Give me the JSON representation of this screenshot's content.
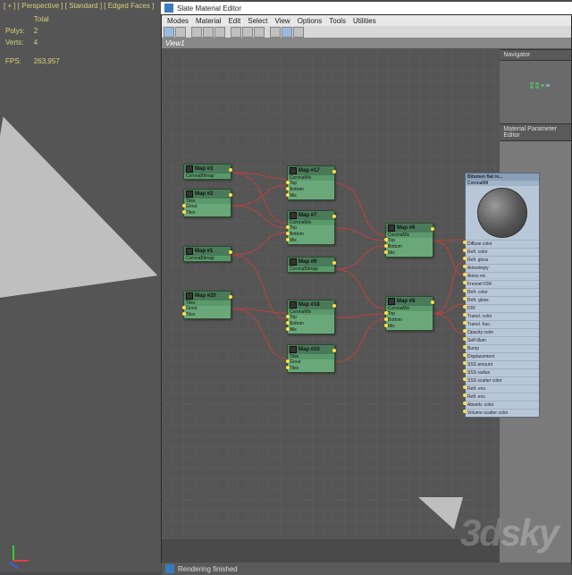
{
  "viewport": {
    "label": "[ + ] [ Perspective ] [ Standard ] [ Edged Faces ]",
    "stats": {
      "polys_l": "Polys:",
      "polys": "2",
      "verts_l": "Verts:",
      "verts": "4",
      "fps_l": "FPS:",
      "fps": "263,957",
      "total": "Total"
    }
  },
  "editor": {
    "title": "Slate Material Editor",
    "menus": [
      "Modes",
      "Material",
      "Edit",
      "Select",
      "View",
      "Options",
      "Tools",
      "Utilities"
    ],
    "view": "View1",
    "navigator": "Navigator",
    "paramEditor": "Material Parameter Editor",
    "status": "Rendering finished"
  },
  "nodes": {
    "n1": {
      "t": "Map #3",
      "s": "CoronaBitmap"
    },
    "n2": {
      "t": "Map #2",
      "s": "Tiles",
      "r": [
        "Grout",
        "Tiles"
      ]
    },
    "n3": {
      "t": "Map #1",
      "s": "CoronaBitmap"
    },
    "n4": {
      "t": "Map #20",
      "s": "Tiles",
      "r": [
        "Grout",
        "Tiles"
      ]
    },
    "n5": {
      "t": "Map #17",
      "s": "CoronaMix",
      "r": [
        "Top",
        "Bottom",
        "Mix"
      ]
    },
    "n6": {
      "t": "Map #7",
      "s": "CoronaMix",
      "r": [
        "Top",
        "Bottom",
        "Mix"
      ]
    },
    "n7": {
      "t": "Map #9",
      "s": "CoronaBitmap"
    },
    "n8": {
      "t": "Map #18",
      "s": "CoronaMix",
      "r": [
        "Top",
        "Bottom",
        "Mix"
      ]
    },
    "n9": {
      "t": "Map #10",
      "s": "Tiles",
      "r": [
        "Grout",
        "Tiles"
      ]
    },
    "n10": {
      "t": "Map #6",
      "s": "CoronaMix",
      "r": [
        "Top",
        "Bottom",
        "Mix"
      ]
    },
    "n11": {
      "t": "Map #8",
      "s": "CoronaMix",
      "r": [
        "Top",
        "Bottom",
        "Mix"
      ]
    }
  },
  "mat": {
    "t": "Bitumen flat ro...",
    "s": "CoronaMtl",
    "rows": [
      "Diffuse color",
      "Refl. color",
      "Refl. gloss",
      "Anisotropy",
      "Aniso rot.",
      "Fresnel IOR",
      "Refr. color",
      "Refr. gloss",
      "IOR",
      "Transl. color",
      "Transl. frac.",
      "Opacity color",
      "Self-Illum",
      "Bump",
      "Displacement",
      "SSS amount",
      "SSS radius",
      "SSS scatter color",
      "Refr. env.",
      "Refl. env.",
      "Absorb. color",
      "Volume scatter color"
    ]
  },
  "watermark": "3dsky"
}
